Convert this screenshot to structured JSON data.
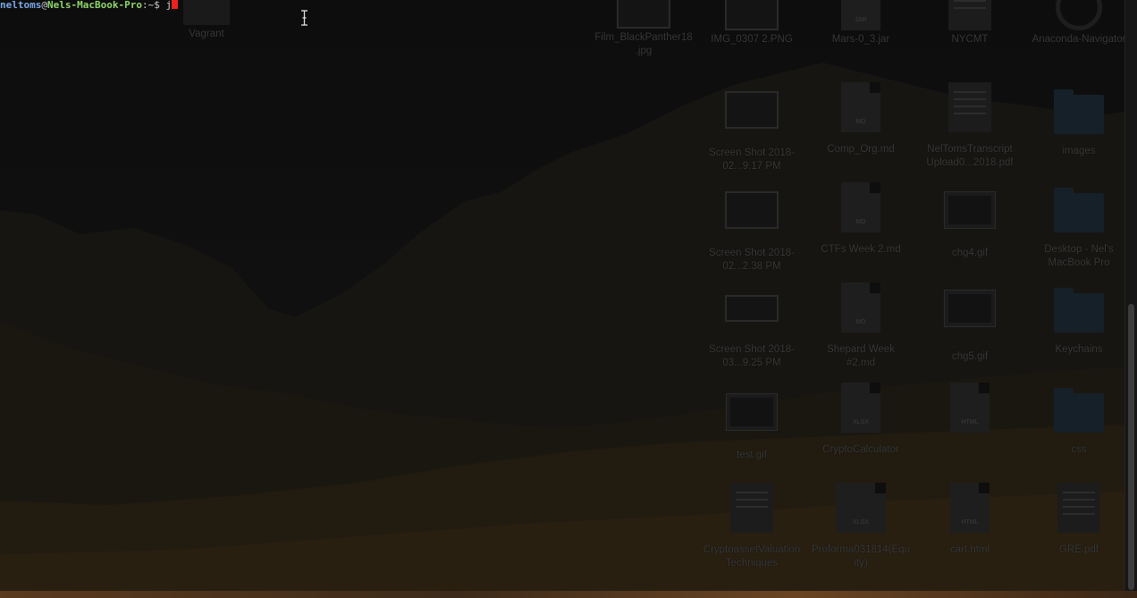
{
  "terminal": {
    "user": "neltoms",
    "at": "@",
    "host": "Nels-MacBook-Pro",
    "path": ":~",
    "prompt_symbol": "$",
    "typed_input": "j"
  },
  "desktop_icons": {
    "vagrant": "Vagrant",
    "film_black_panther": "Film_BlackPanther18.jpg",
    "img_0307": "IMG_0307 2.PNG",
    "mars": "Mars-0_3.jar",
    "nycm": "NYCMT",
    "anaconda": "Anaconda-Navigator",
    "screenshot1": "Screen Shot 2018-02...9.17 PM",
    "comp_org": "Comp_Org.md",
    "transcript": "NelTomsTranscript Upload0...2018.pdf",
    "images": "images",
    "screenshot2": "Screen Shot 2018-02...2.38 PM",
    "ctfs": "CTFs Week 2.md",
    "chg4": "chg4.gif",
    "desktop_nels": "Desktop - Nel's MacBook Pro",
    "screenshot3": "Screen Shot 2018-03...9.25 PM",
    "shepard": "Shepard Week #2.md",
    "chg5": "chg5.gif",
    "keychains": "Keychains",
    "test_gif": "test.gif",
    "crypto_calc": "CryptoCalculator",
    "css": "css",
    "crypto_asset": "CryptoassetValuationTechniques",
    "proforma": "Proforma031814(Equity)",
    "cart": "cart.html",
    "gre": "GRE.pdf"
  },
  "doc_tags": {
    "md": "MD",
    "jar": "JAR",
    "html": "HTML",
    "xlsx": "XLSX"
  },
  "colors": {
    "user": "#7aa9e8",
    "host": "#8fd66b",
    "cursor": "#ee2020"
  }
}
